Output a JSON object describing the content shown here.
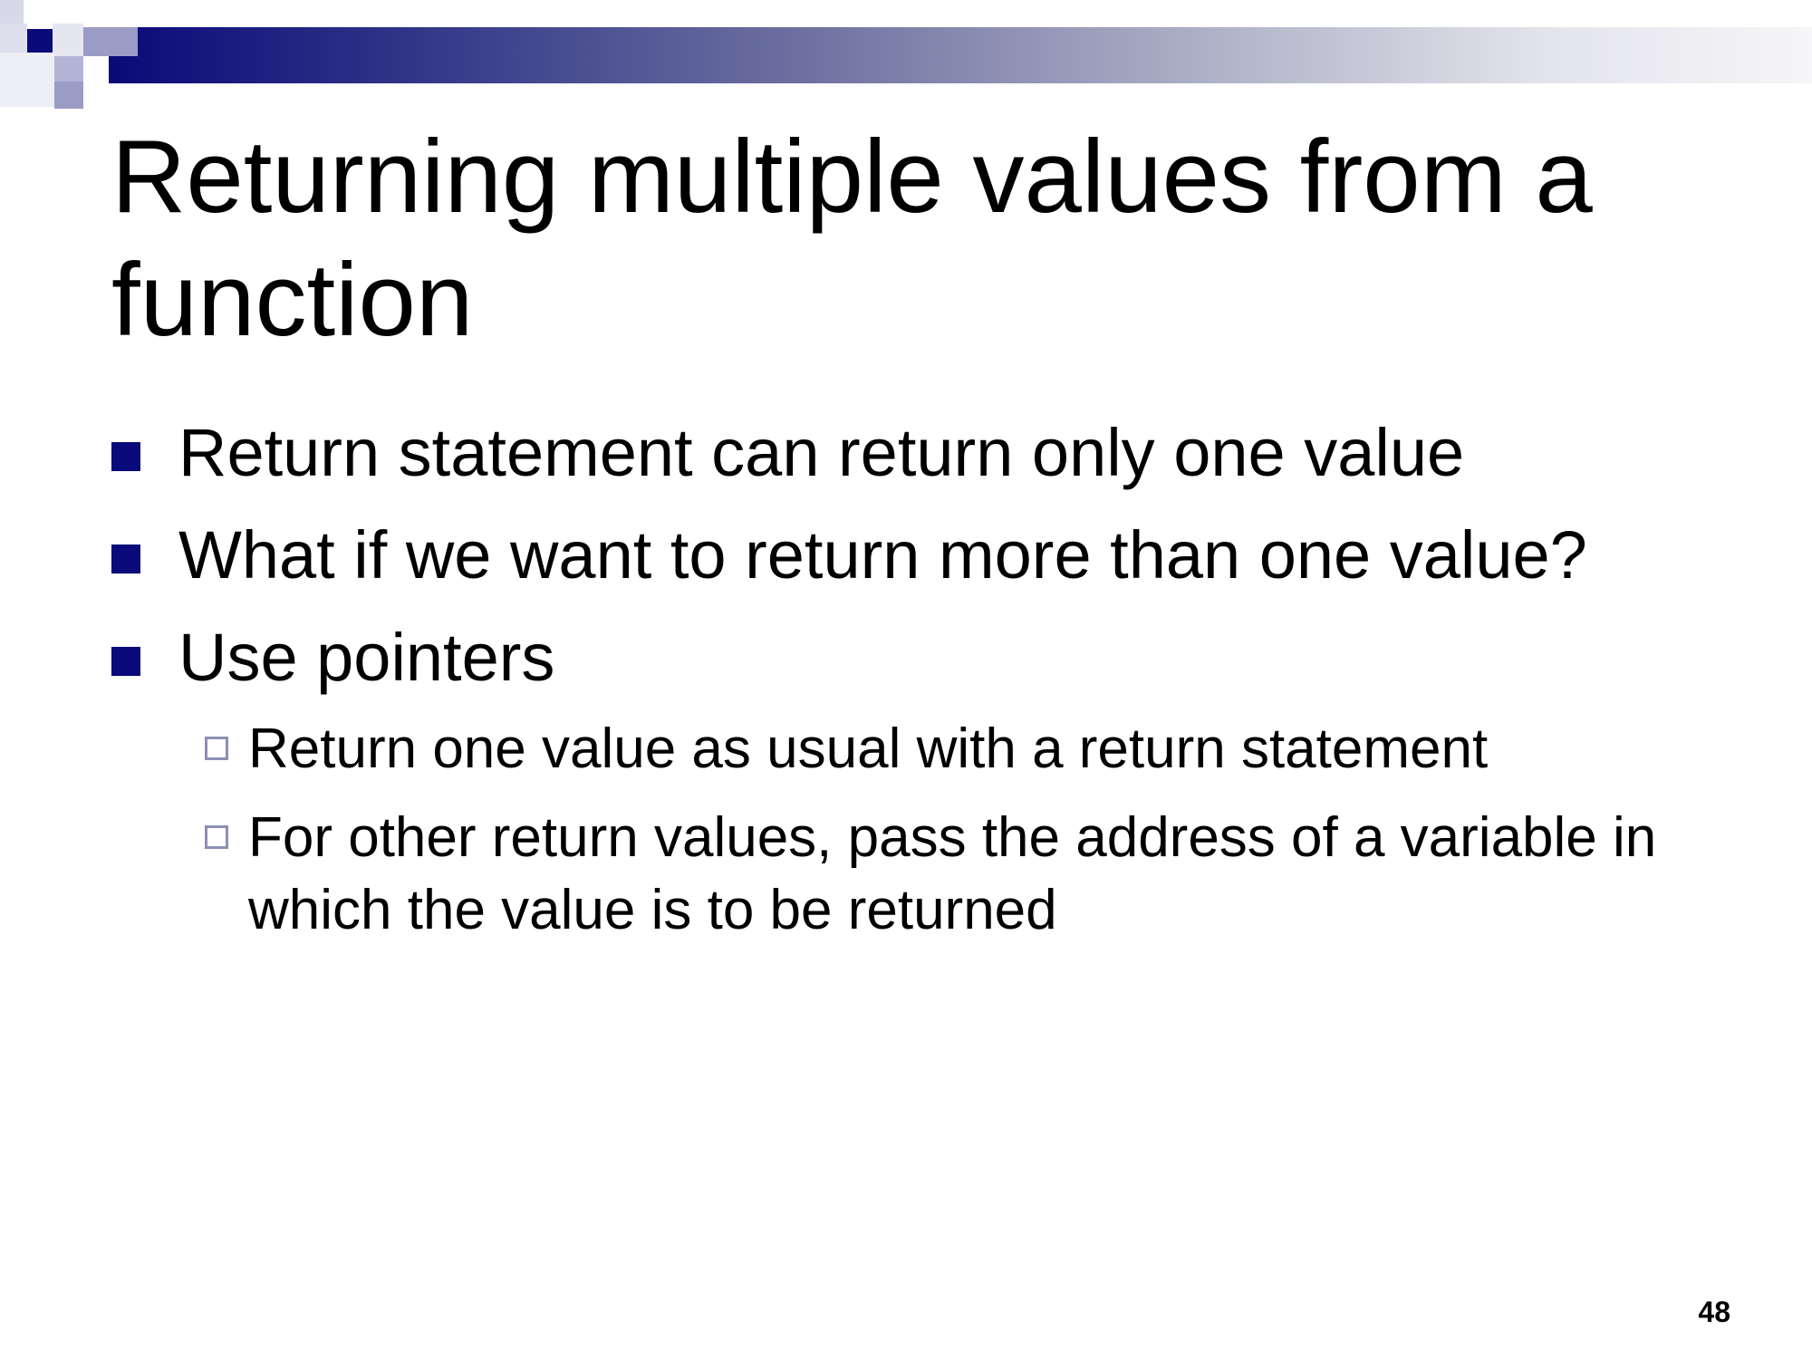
{
  "slide": {
    "title": "Returning multiple values from a function",
    "bullets": [
      {
        "text": "Return statement can return only one value"
      },
      {
        "text": "What if we want to return more than one value?"
      },
      {
        "text": "Use pointers"
      }
    ],
    "sub_bullets": [
      {
        "text": "Return one value as usual with a return statement"
      },
      {
        "text": "For other return values, pass the address of a variable in which the value is to be returned"
      }
    ],
    "page_number": "48"
  },
  "colors": {
    "accent": "#0a0a7a",
    "sub_marker_border": "#8d8fb4",
    "text": "#000000",
    "background": "#ffffff"
  }
}
